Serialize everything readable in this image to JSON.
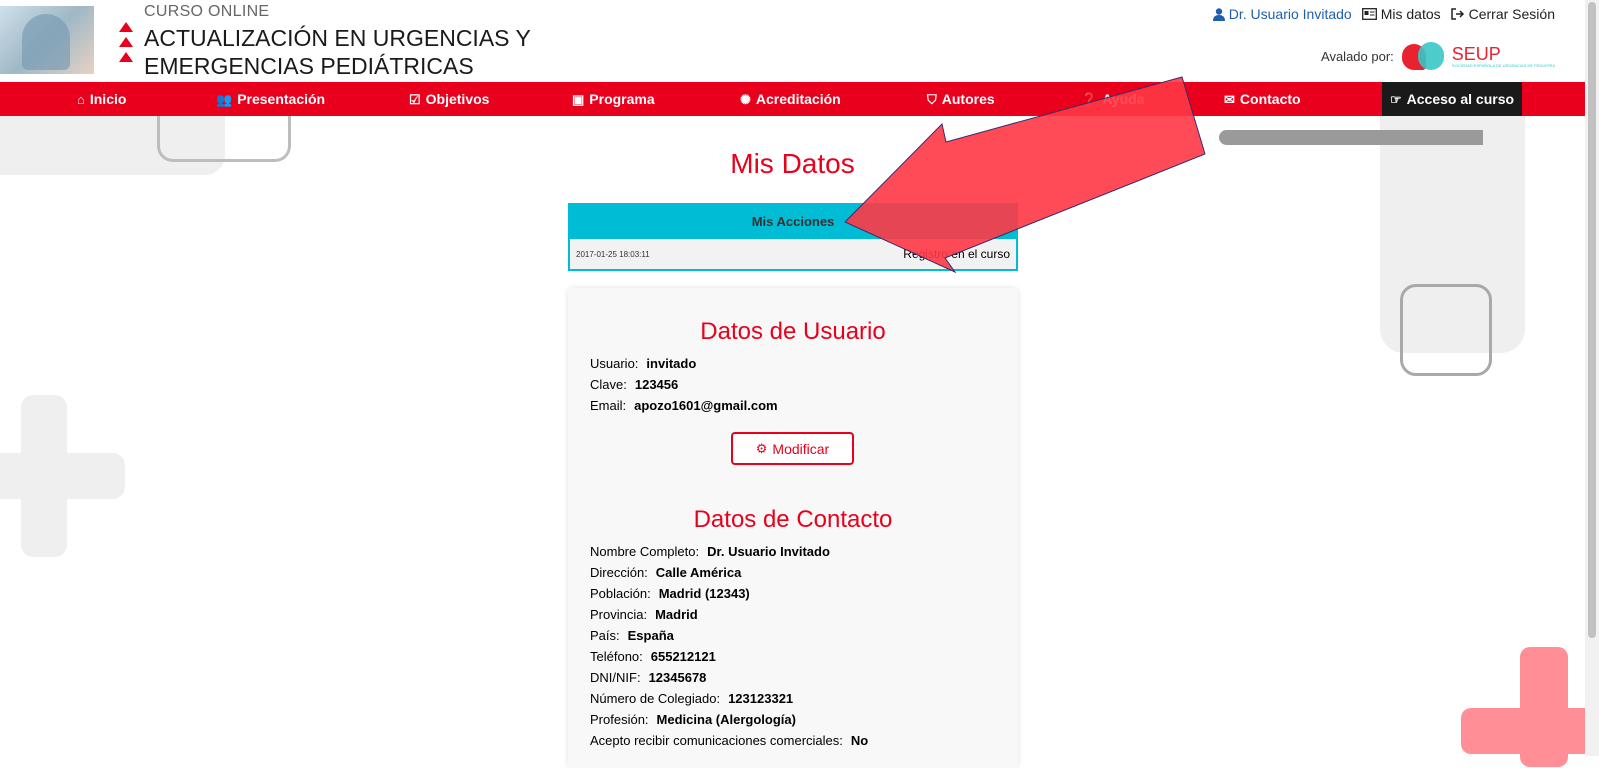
{
  "header": {
    "course_sub": "CURSO ONLINE",
    "course_title_line1": "ACTUALIZACIÓN EN URGENCIAS Y",
    "course_title_line2": "EMERGENCIAS PEDIÁTRICAS",
    "user_name": "Dr. Usuario Invitado",
    "my_data_link": "Mis datos",
    "logout_link": "Cerrar Sesión",
    "avalado_label": "Avalado por:",
    "sponsor_name": "SEUP",
    "sponsor_tagline": "SOCIEDAD ESPAÑOLA DE URGENCIAS DE PEDIATRÍA"
  },
  "nav": {
    "items": [
      {
        "label": "Inicio",
        "icon": "home-icon"
      },
      {
        "label": "Presentación",
        "icon": "users-icon"
      },
      {
        "label": "Objetivos",
        "icon": "check-square-icon"
      },
      {
        "label": "Programa",
        "icon": "calendar-check-icon"
      },
      {
        "label": "Acreditación",
        "icon": "certificate-icon"
      },
      {
        "label": "Autores",
        "icon": "shield-icon"
      },
      {
        "label": "Ayuda",
        "icon": "question-circle-icon"
      },
      {
        "label": "Contacto",
        "icon": "envelope-icon"
      },
      {
        "label": "Acceso al curso",
        "icon": "hand-pointer-icon"
      }
    ],
    "active_color": "#1a1a1a",
    "bar_color": "#e8001c"
  },
  "main": {
    "title": "Mis Datos",
    "actions": {
      "header": "Mis Acciones",
      "rows": [
        {
          "date": "2017-01-25 18:03:11",
          "action": "Registro en el curso"
        }
      ]
    },
    "user_section": {
      "title": "Datos de Usuario",
      "fields": [
        {
          "label": "Usuario:",
          "value": "invitado"
        },
        {
          "label": "Clave:",
          "value": "123456"
        },
        {
          "label": "Email:",
          "value": "apozo1601@gmail.com"
        }
      ],
      "modify_button": "Modificar"
    },
    "contact_section": {
      "title": "Datos de Contacto",
      "fields": [
        {
          "label": "Nombre Completo:",
          "value": "Dr. Usuario Invitado"
        },
        {
          "label": "Dirección:",
          "value": "Calle América"
        },
        {
          "label": "Población:",
          "value": "Madrid (12343)"
        },
        {
          "label": "Provincia:",
          "value": "Madrid"
        },
        {
          "label": "País:",
          "value": "España"
        },
        {
          "label": "Teléfono:",
          "value": "655212121"
        },
        {
          "label": "DNI/NIF:",
          "value": "12345678"
        },
        {
          "label": "Número de Colegiado:",
          "value": "123123321"
        },
        {
          "label": "Profesión:",
          "value": "Medicina (Alergología)"
        },
        {
          "label": "Acepto recibir comunicaciones comerciales:",
          "value": "No"
        }
      ]
    }
  },
  "colors": {
    "accent_red": "#e8001c",
    "actions_teal": "#00bcd4",
    "overlay_arrow": "#ff4a55"
  }
}
